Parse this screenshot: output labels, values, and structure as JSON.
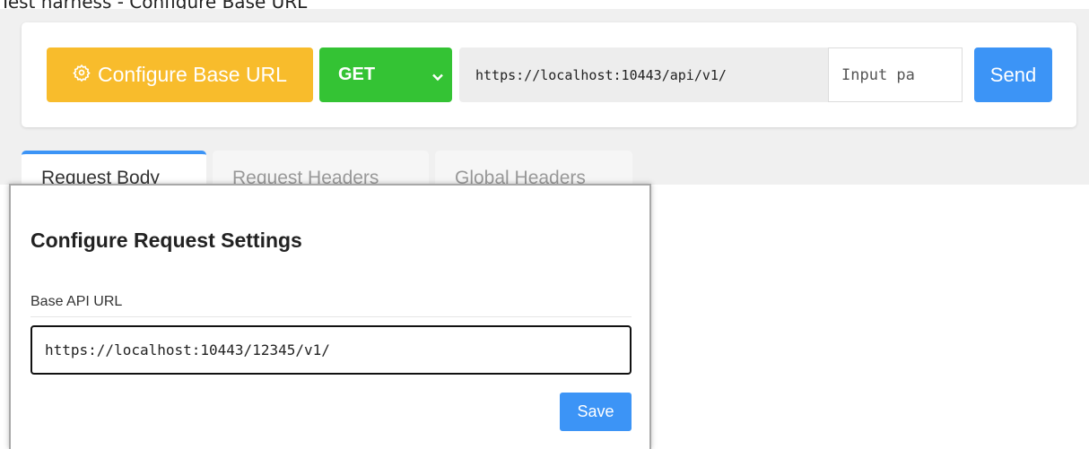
{
  "page_title": "Test harness - Configure Base URL",
  "toolbar": {
    "configure_label": "Configure Base URL",
    "configure_icon": "gear-icon",
    "method": "GET",
    "base_url": "https://localhost:10443/api/v1/",
    "path_placeholder": "Input pa",
    "send_label": "Send"
  },
  "tabs": [
    {
      "label": "Request Body",
      "active": true
    },
    {
      "label": "Request Headers",
      "active": false
    },
    {
      "label": "Global Headers",
      "active": false
    }
  ],
  "modal": {
    "title": "Configure Request Settings",
    "field_label": "Base API URL",
    "field_value": "https://localhost:10443/12345/v1/",
    "save_label": "Save"
  },
  "colors": {
    "configure": "#f8bc2c",
    "method": "#34c334",
    "send": "#3c94f6",
    "active_tab": "#3c94f6"
  }
}
